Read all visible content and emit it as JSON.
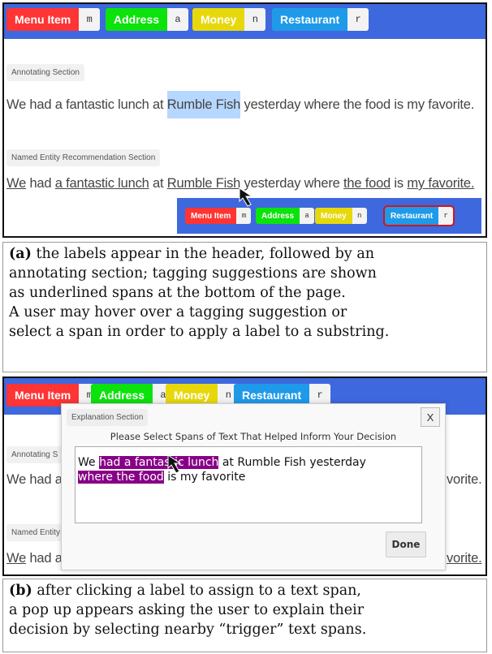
{
  "labels": [
    {
      "name": "Menu Item",
      "key": "m",
      "color": "#ff3434"
    },
    {
      "name": "Address",
      "key": "a",
      "color": "#0ce20c"
    },
    {
      "name": "Money",
      "key": "n",
      "color": "#e7d80c"
    },
    {
      "name": "Restaurant",
      "key": "r",
      "color": "#1e9ae9"
    }
  ],
  "panel_a": {
    "annotating_section": {
      "tag": "Annotating Section",
      "before": "We had a fantastic lunch at ",
      "highlighted": "Rumble Fish",
      "after": " yesterday where the food is my favorite."
    },
    "recommendation_section": {
      "tag": "Named Entity Recommendation Section",
      "segments": [
        {
          "text": "We",
          "underlined": true
        },
        {
          "text": " had ",
          "underlined": false
        },
        {
          "text": "a fantastic lunch",
          "underlined": true
        },
        {
          "text": " at ",
          "underlined": false
        },
        {
          "text": "Rumble Fish",
          "underlined": true
        },
        {
          "text": " yesterday where ",
          "underlined": false
        },
        {
          "text": "the food",
          "underlined": true
        },
        {
          "text": " is ",
          "underlined": false
        },
        {
          "text": "my favorite.",
          "underlined": true
        }
      ],
      "selected_label": "Restaurant"
    },
    "caption": {
      "marker": "(a)",
      "lines": [
        " the labels appear in the header, followed by an",
        "annotating section; tagging suggestions are shown",
        "as underlined spans at the bottom of the page.",
        "A user may hover over a tagging suggestion or",
        "select a span in order to apply a label to a substring."
      ]
    }
  },
  "panel_b": {
    "background": {
      "annotating_tag": "Annotating S",
      "sentence_left": "We had a",
      "sentence_right": "vorite.",
      "recommendation_tag": "Named Entity",
      "rec_left_u": "We",
      "rec_left": " had a",
      "rec_right": "vorite."
    },
    "modal": {
      "tag": "Explanation Section",
      "close_label": "X",
      "prompt": "Please Select Spans of Text That Helped Inform Your Decision",
      "text": {
        "line1_plain_a": "We ",
        "line1_selected": "had a fantastic lunch",
        "line1_plain_b": " at Rumble Fish yesterday",
        "line2_selected": "where the food",
        "line2_plain": " is my favorite"
      },
      "done_label": "Done"
    },
    "caption": {
      "marker": "(b)",
      "lines": [
        " after clicking a label to assign to a text span,",
        "a pop up appears asking the user to explain their",
        "decision by selecting nearby “trigger” text spans."
      ]
    }
  }
}
